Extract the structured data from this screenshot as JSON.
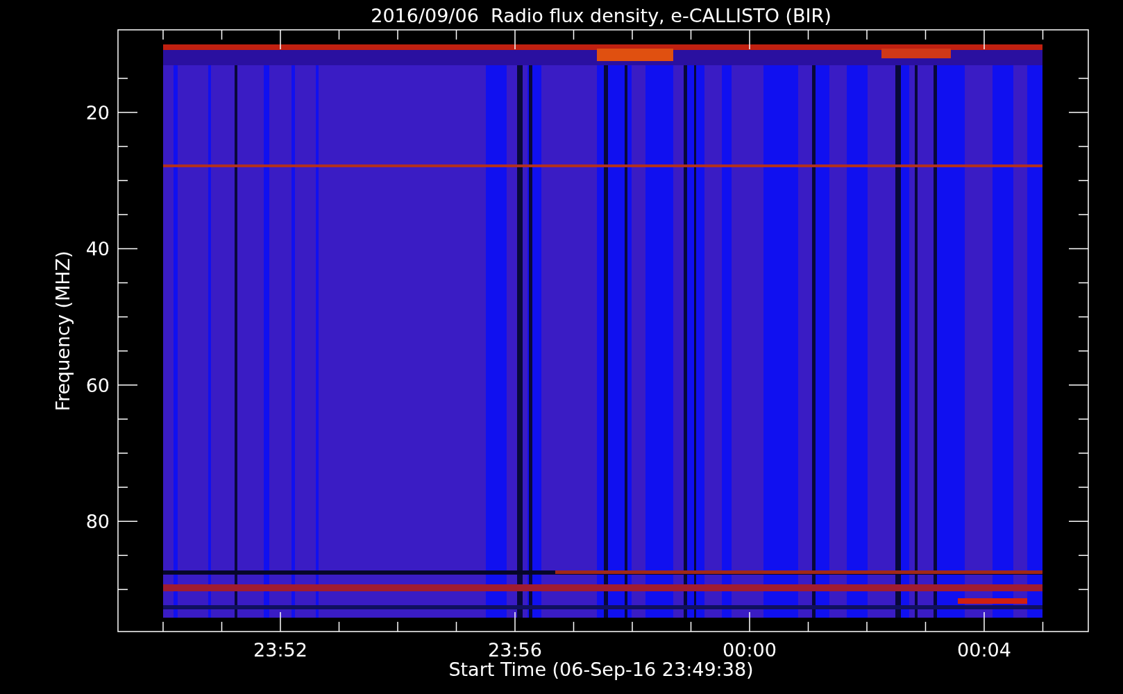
{
  "title": "2016/09/06  Radio flux density, e-CALLISTO (BIR)",
  "x_axis": {
    "label": "Start Time (06-Sep-16 23:49:38)",
    "ticks": [
      "23:52",
      "23:56",
      "00:00",
      "00:04"
    ]
  },
  "y_axis": {
    "label": "Frequency (MHZ)",
    "ticks": [
      "20",
      "40",
      "60",
      "80"
    ]
  }
}
